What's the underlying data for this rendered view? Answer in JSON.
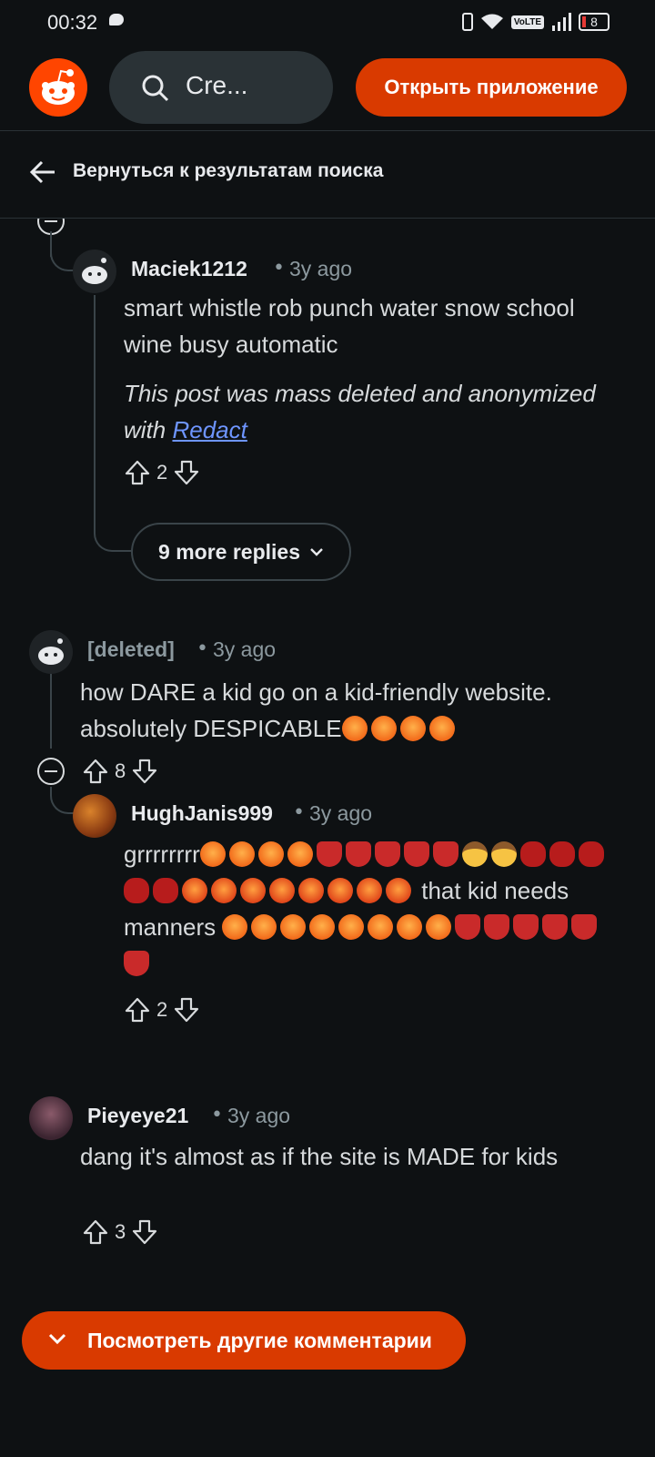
{
  "status_bar": {
    "time": "00:32",
    "volte": "VoLTE",
    "battery": "8"
  },
  "header": {
    "search_text": "Cre...",
    "open_app": "Открыть приложение"
  },
  "back": {
    "label": "Вернуться к результатам поиска"
  },
  "comments": [
    {
      "user": "Maciek1212",
      "time": "3y ago",
      "text": "smart whistle rob punch water snow school wine busy automatic",
      "italic_prefix": "This post was mass deleted and anonymized with ",
      "link": "Redact",
      "votes": "2",
      "more_replies": "9 more replies"
    },
    {
      "user": "[deleted]",
      "time": "3y ago",
      "text": "how DARE a kid go on a kid-friendly website. absolutely DESPICABLE",
      "votes": "8"
    },
    {
      "user": "HughJanis999",
      "time": "3y ago",
      "text_prefix": "grrrrrrrr",
      "text_mid": " that kid needs manners ",
      "votes": "2"
    },
    {
      "user": "Pieyeye21",
      "time": "3y ago",
      "text": "dang it's almost as if the site is MADE for kids",
      "votes": "3"
    }
  ],
  "view_more": "Посмотреть другие комментарии",
  "colors": {
    "accent": "#d93a00",
    "background": "#0e1113",
    "link": "#6e95ff"
  }
}
